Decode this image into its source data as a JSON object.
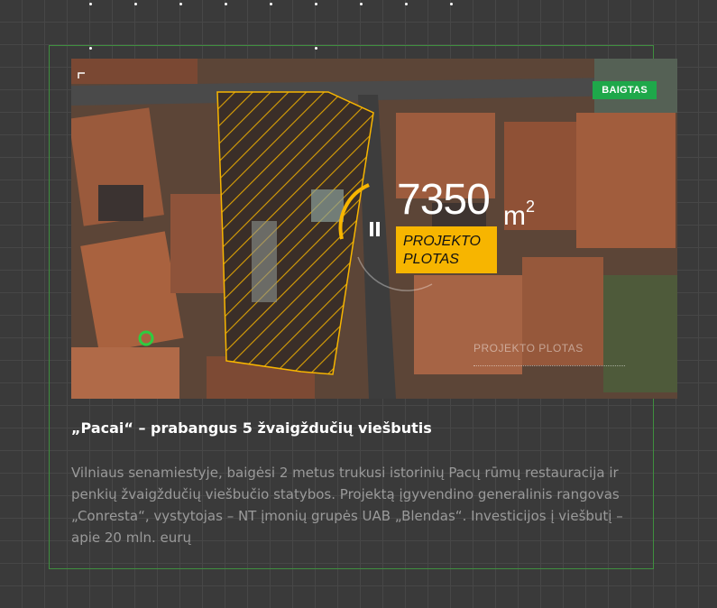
{
  "card": {
    "status_badge": "BAIGTAS",
    "area": {
      "value": "7350",
      "unit": "m",
      "unit_sup": "2",
      "label": "PROJEKTO\nPLOTAS"
    },
    "watermark": "PROJEKTO PLOTAS",
    "title": "„Pacai“ – prabangus 5 žvaigždučių viešbutis",
    "description": "Vilniaus senamiestyje, baigėsi 2 metus trukusi istorinių Pacų rūmų restauracija ir penkių žvaigždučių viešbučio statybos. Projektą įgyvendino generalinis rangovas „Conresta“, vystytojas – NT įmonių grupės UAB „Blendas“. Investicijos į viešbutį – apie 20 mln. eurų"
  },
  "colors": {
    "accent": "#f7b500",
    "badge": "#1ea84a",
    "frame": "#3f8f3f",
    "background": "#3a3a3a"
  },
  "icons": [
    "pause-icon",
    "location-marker-icon"
  ]
}
